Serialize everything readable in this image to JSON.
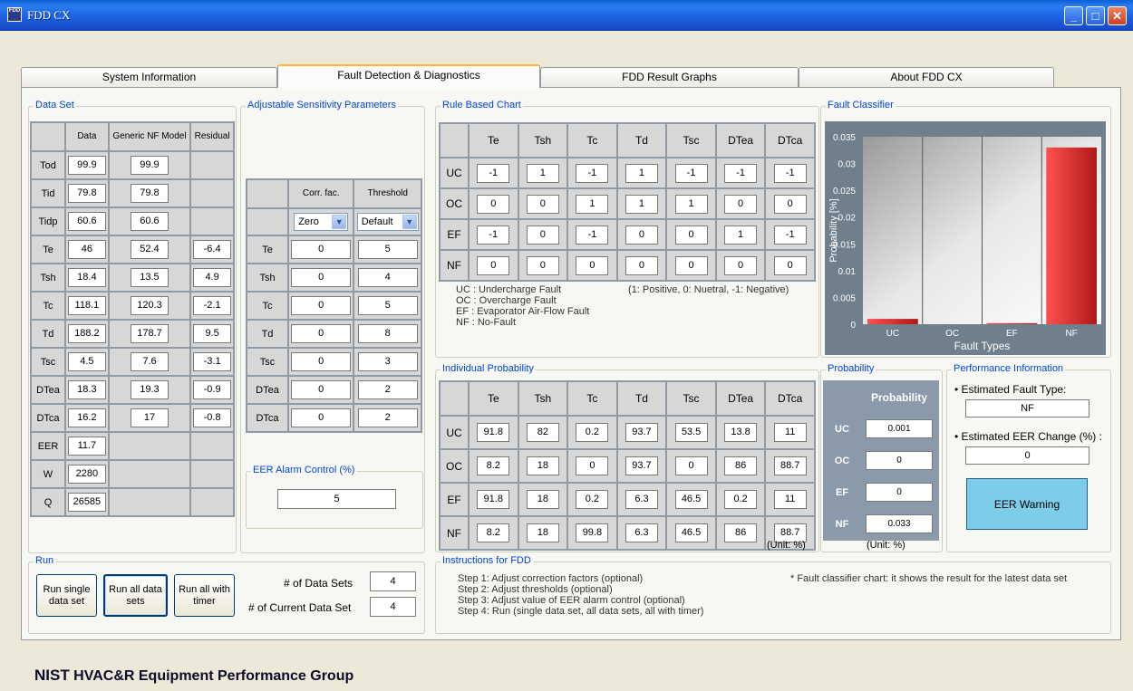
{
  "window": {
    "title": "FDD CX",
    "icon_text": "FDD"
  },
  "tabs": [
    "System Information",
    "Fault Detection & Diagnostics",
    "FDD Result Graphs",
    "About FDD CX"
  ],
  "data_set": {
    "label": "Data Set",
    "headers": [
      "Data",
      "Generic NF Model",
      "Residual"
    ],
    "rows": [
      {
        "name": "Tod",
        "data": "99.9",
        "model": "99.9",
        "residual": ""
      },
      {
        "name": "Tid",
        "data": "79.8",
        "model": "79.8",
        "residual": ""
      },
      {
        "name": "Tidp",
        "data": "60.6",
        "model": "60.6",
        "residual": ""
      },
      {
        "name": "Te",
        "data": "46",
        "model": "52.4",
        "residual": "-6.4"
      },
      {
        "name": "Tsh",
        "data": "18.4",
        "model": "13.5",
        "residual": "4.9"
      },
      {
        "name": "Tc",
        "data": "118.1",
        "model": "120.3",
        "residual": "-2.1"
      },
      {
        "name": "Td",
        "data": "188.2",
        "model": "178.7",
        "residual": "9.5"
      },
      {
        "name": "Tsc",
        "data": "4.5",
        "model": "7.6",
        "residual": "-3.1"
      },
      {
        "name": "DTea",
        "data": "18.3",
        "model": "19.3",
        "residual": "-0.9"
      },
      {
        "name": "DTca",
        "data": "16.2",
        "model": "17",
        "residual": "-0.8"
      },
      {
        "name": "EER",
        "data": "11.7",
        "model": "",
        "residual": ""
      },
      {
        "name": "W",
        "data": "2280",
        "model": "",
        "residual": ""
      },
      {
        "name": "Q",
        "data": "26585",
        "model": "",
        "residual": ""
      }
    ]
  },
  "sensitivity": {
    "label": "Adjustable Sensitivity Parameters",
    "headers": [
      "Corr. fac.",
      "Threshold"
    ],
    "corr_select": "Zero",
    "threshold_select": "Default",
    "rows": [
      {
        "name": "Te",
        "corr": "0",
        "threshold": "5"
      },
      {
        "name": "Tsh",
        "corr": "0",
        "threshold": "4"
      },
      {
        "name": "Tc",
        "corr": "0",
        "threshold": "5"
      },
      {
        "name": "Td",
        "corr": "0",
        "threshold": "8"
      },
      {
        "name": "Tsc",
        "corr": "0",
        "threshold": "3"
      },
      {
        "name": "DTea",
        "corr": "0",
        "threshold": "2"
      },
      {
        "name": "DTca",
        "corr": "0",
        "threshold": "2"
      }
    ]
  },
  "eer_alarm": {
    "label": "EER Alarm Control (%)",
    "value": "5"
  },
  "rule_chart": {
    "label": "Rule Based Chart",
    "headers": [
      "Te",
      "Tsh",
      "Tc",
      "Td",
      "Tsc",
      "DTea",
      "DTca"
    ],
    "rows": [
      {
        "name": "UC",
        "values": [
          "-1",
          "1",
          "-1",
          "1",
          "-1",
          "-1",
          "-1"
        ]
      },
      {
        "name": "OC",
        "values": [
          "0",
          "0",
          "1",
          "1",
          "1",
          "0",
          "0"
        ]
      },
      {
        "name": "EF",
        "values": [
          "-1",
          "0",
          "-1",
          "0",
          "0",
          "1",
          "-1"
        ]
      },
      {
        "name": "NF",
        "values": [
          "0",
          "0",
          "0",
          "0",
          "0",
          "0",
          "0"
        ]
      }
    ],
    "legend": [
      "UC : Undercharge Fault",
      "OC : Overcharge Fault",
      "EF : Evaporator Air-Flow Fault",
      "NF : No-Fault"
    ],
    "sign_note": "(1: Positive, 0: Nuetral, -1: Negative)"
  },
  "individual_probability": {
    "label": "Individual Probability",
    "headers": [
      "Te",
      "Tsh",
      "Tc",
      "Td",
      "Tsc",
      "DTea",
      "DTca"
    ],
    "rows": [
      {
        "name": "UC",
        "values": [
          "91.8",
          "82",
          "0.2",
          "93.7",
          "53.5",
          "13.8",
          "11"
        ]
      },
      {
        "name": "OC",
        "values": [
          "8.2",
          "18",
          "0",
          "93.7",
          "0",
          "86",
          "88.7"
        ]
      },
      {
        "name": "EF",
        "values": [
          "91.8",
          "18",
          "0.2",
          "6.3",
          "46.5",
          "0.2",
          "11"
        ]
      },
      {
        "name": "NF",
        "values": [
          "8.2",
          "18",
          "99.8",
          "6.3",
          "46.5",
          "86",
          "88.7"
        ]
      }
    ],
    "unit": "(Unit: %)"
  },
  "fault_classifier": {
    "label": "Fault Classifier"
  },
  "chart_data": {
    "type": "bar",
    "categories": [
      "UC",
      "OC",
      "EF",
      "NF"
    ],
    "values": [
      0.001,
      0,
      0.0002,
      0.033
    ],
    "ylim": [
      0,
      0.035
    ],
    "yticks": [
      "0.035",
      "0.03",
      "0.025",
      "0.02",
      "0.015",
      "0.01",
      "0.005",
      "0"
    ],
    "ylabel": "Probability [%]",
    "xlabel": "Fault Types",
    "bar_color": "#d93030"
  },
  "probability": {
    "label": "Probability",
    "header": "Probability",
    "rows": [
      {
        "name": "UC",
        "value": "0.001"
      },
      {
        "name": "OC",
        "value": "0"
      },
      {
        "name": "EF",
        "value": "0"
      },
      {
        "name": "NF",
        "value": "0.033"
      }
    ],
    "unit": "(Unit: %)"
  },
  "performance": {
    "label": "Performance Information",
    "fault_type_label": "• Estimated Fault Type:",
    "fault_type_value": "NF",
    "eer_change_label": "• Estimated EER Change (%) :",
    "eer_change_value": "0",
    "warning_button": "EER Warning"
  },
  "run": {
    "label": "Run",
    "single": "Run single data set",
    "all": "Run all data sets",
    "timer": "Run all with timer",
    "num_sets_label": "# of Data Sets",
    "num_sets": "4",
    "current_label": "# of Current Data Set",
    "current": "4"
  },
  "instructions": {
    "label": "Instructions for FDD",
    "steps": [
      "Step 1: Adjust correction factors (optional)",
      "Step 2: Adjust  thresholds (optional)",
      "Step 3: Adjust value of EER alarm control (optional)",
      "Step 4: Run (single data set, all data sets, all with timer)"
    ],
    "note": "* Fault classifier chart: it shows the result for the latest data set"
  },
  "footer": {
    "bold": "NIST",
    "rest": " HVAC&R Equipment Performance Group"
  }
}
